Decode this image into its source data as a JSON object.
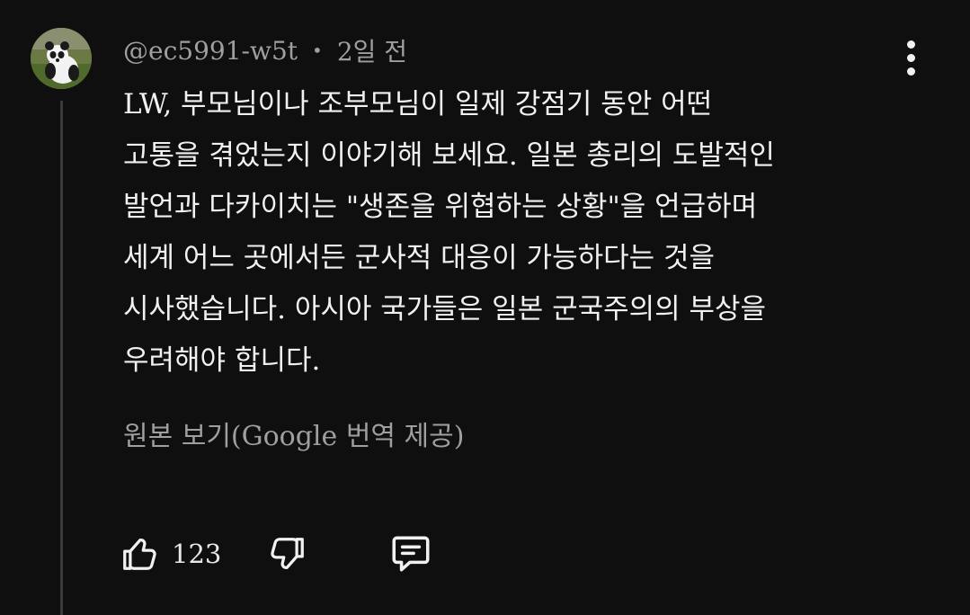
{
  "comment": {
    "author": "@ec5991-w5t",
    "separator": "•",
    "time": "2일 전",
    "lines": [
      "LW, 부모님이나 조부모님이 일제 강점기 동안 어떤",
      "고통을 겪었는지 이야기해 보세요. 일본 총리의 도발적인",
      "발언과 다카이치는 \"생존을 위협하는 상황\"을 언급하며",
      "세계 어느 곳에서든 군사적 대응이 가능하다는 것을",
      "시사했습니다. 아시아 국가들은 일본 군국주의의 부상을",
      "우려해야 합니다."
    ],
    "translate_link": "원본 보기(Google 번역 제공)",
    "like_count": "123"
  },
  "icons": {
    "avatar": "panda-avatar",
    "menu": "more-vert-icon",
    "like": "thumb-up-icon",
    "dislike": "thumb-down-icon",
    "reply": "comment-reply-icon"
  },
  "colors": {
    "background": "#0f0f0f",
    "text": "#f1f1f1",
    "secondary_text": "#9f9f9f",
    "thread_line": "#3a3a3a"
  }
}
